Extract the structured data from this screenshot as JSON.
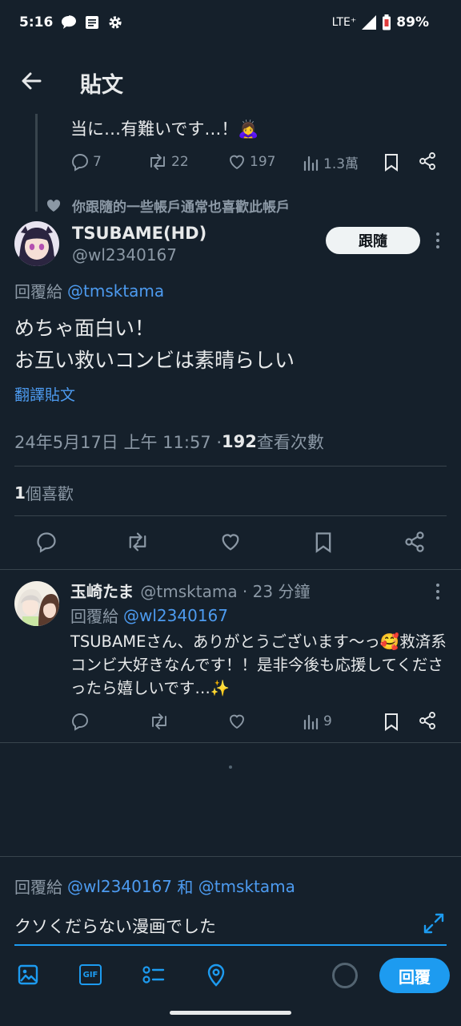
{
  "status_bar": {
    "time": "5:16",
    "network": "LTE⁺",
    "battery": "89%"
  },
  "header": {
    "title": "貼文"
  },
  "parent_tweet": {
    "text_tail": "当に…有難いです…！🙇‍♀️",
    "replies": "7",
    "retweets": "22",
    "likes": "197",
    "views": "1.3萬"
  },
  "social_context": "你跟隨的一些帳戶通常也喜歡此帳戶",
  "main_tweet": {
    "display_name": "TSUBAME(HD)",
    "handle": "@wl2340167",
    "follow_label": "跟隨",
    "reply_to_prefix": "回覆給",
    "reply_to_handle": "@tmsktama",
    "text_line1": "めちゃ面白い！",
    "text_line2": "お互い救いコンビは素晴らしい",
    "translate": "翻譯貼文",
    "timestamp": "24年5月17日 上午 11:57 · ",
    "view_count": "192",
    "view_label": " 查看次數",
    "like_count": "1",
    "like_label": " 個喜歡"
  },
  "reply_tweet": {
    "display_name": "玉崎たま",
    "handle_time": "@tmsktama · 23 分鐘",
    "reply_to_prefix": "回覆給",
    "reply_to_handle": "@wl2340167",
    "text": "TSUBAMEさん、ありがとうございます〜っ🥰救済系コンビ大好きなんです！！是非今後も応援してくださったら嬉しいです…✨",
    "views": "9"
  },
  "composer": {
    "reply_to_prefix": "回覆給",
    "reply_to_handle1": "@wl2340167",
    "reply_to_joiner": " 和 ",
    "reply_to_handle2": "@tmsktama",
    "input_value": "クソくだらない漫画でした",
    "gif_label": "GIF",
    "reply_button": "回覆"
  },
  "colors": {
    "background": "#15202b",
    "accent": "#1d9bf0",
    "link": "#4d9bf0",
    "muted": "#8b98a5",
    "divider": "#38444d"
  }
}
